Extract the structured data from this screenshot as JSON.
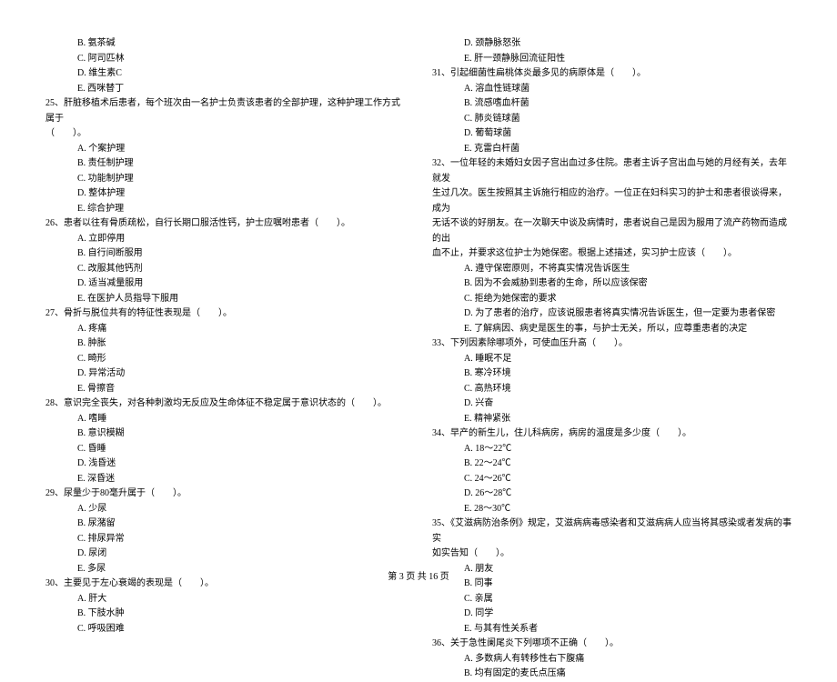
{
  "left": {
    "preOptions": [
      "B. 氨茶碱",
      "C. 阿司匹林",
      "D. 维生素C",
      "E. 西咪替丁"
    ],
    "q25": {
      "stem": "25、肝脏移植术后患者，每个班次由一名护士负责该患者的全部护理，这种护理工作方式属于",
      "stem2": "（　　）。",
      "opts": [
        "A. 个案护理",
        "B. 责任制护理",
        "C. 功能制护理",
        "D. 整体护理",
        "E. 综合护理"
      ]
    },
    "q26": {
      "stem": "26、患者以往有骨质疏松，自行长期口服活性钙，护士应嘱咐患者（　　）。",
      "opts": [
        "A. 立即停用",
        "B. 自行间断服用",
        "C. 改服其他钙剂",
        "D. 适当减量服用",
        "E. 在医护人员指导下服用"
      ]
    },
    "q27": {
      "stem": "27、骨折与脱位共有的特征性表现是（　　）。",
      "opts": [
        "A. 疼痛",
        "B. 肿胀",
        "C. 畸形",
        "D. 异常活动",
        "E. 骨擦音"
      ]
    },
    "q28": {
      "stem": "28、意识完全丧失，对各种刺激均无反应及生命体征不稳定属于意识状态的（　　）。",
      "opts": [
        "A. 嗜睡",
        "B. 意识模糊",
        "C. 昏睡",
        "D. 浅昏迷",
        "E. 深昏迷"
      ]
    },
    "q29": {
      "stem": "29、尿量少于80毫升属于（　　）。",
      "opts": [
        "A. 少尿",
        "B. 尿潴留",
        "C. 排尿异常",
        "D. 尿闭",
        "E. 多尿"
      ]
    },
    "q30": {
      "stem": "30、主要见于左心衰竭的表现是（　　）。",
      "opts": [
        "A. 肝大",
        "B. 下肢水肿",
        "C. 呼吸困难"
      ]
    }
  },
  "right": {
    "preOptions": [
      "D. 颈静脉怒张",
      "E. 肝一颈静脉回流征阳性"
    ],
    "q31": {
      "stem": "31、引起细菌性扁桃体炎最多见的病原体是（　　）。",
      "opts": [
        "A. 溶血性链球菌",
        "B. 流感嗜血杆菌",
        "C. 肺炎链球菌",
        "D. 葡萄球菌",
        "E. 克雷白杆菌"
      ]
    },
    "q32": {
      "stem1": "32、一位年轻的未婚妇女因子宫出血过多住院。患者主诉子宫出血与她的月经有关，去年就发",
      "stem2": "生过几次。医生按照其主诉施行相应的治疗。一位正在妇科实习的护士和患者很谈得来，成为",
      "stem3": "无话不谈的好朋友。在一次聊天中谈及病情时，患者说自己是因为服用了流产药物而造成的出",
      "stem4": "血不止，并要求这位护士为她保密。根据上述描述，实习护士应该（　　）。",
      "opts": [
        "A. 遵守保密原则，不将真实情况告诉医生",
        "B. 因为不会威胁到患者的生命，所以应该保密",
        "C. 拒绝为她保密的要求",
        "D. 为了患者的治疗，应该说服患者将真实情况告诉医生，但一定要为患者保密",
        "E. 了解病因、病史是医生的事，与护士无关，所以，应尊重患者的决定"
      ]
    },
    "q33": {
      "stem": "33、下列因素除哪项外，可使血压升高（　　）。",
      "opts": [
        "A. 睡眠不足",
        "B. 寒冷环境",
        "C. 高热环境",
        "D. 兴奋",
        "E. 精神紧张"
      ]
    },
    "q34": {
      "stem": "34、早产的新生儿，住儿科病房，病房的温度是多少度（　　）。",
      "opts": [
        "A. 18～22℃",
        "B. 22～24℃",
        "C. 24～26℃",
        "D. 26～28℃",
        "E. 28～30℃"
      ]
    },
    "q35": {
      "stem1": "35、《艾滋病防治条例》规定，艾滋病病毒感染者和艾滋病病人应当将其感染或者发病的事实",
      "stem2": "如实告知（　　）。",
      "opts": [
        "A. 朋友",
        "B. 同事",
        "C. 亲属",
        "D. 同学",
        "E. 与其有性关系者"
      ]
    },
    "q36": {
      "stem": "36、关于急性阑尾炎下列哪项不正确（　　）。",
      "opts": [
        "A. 多数病人有转移性右下腹痛",
        "B. 均有固定的麦氏点压痛"
      ]
    }
  },
  "footer": "第 3 页 共 16 页"
}
